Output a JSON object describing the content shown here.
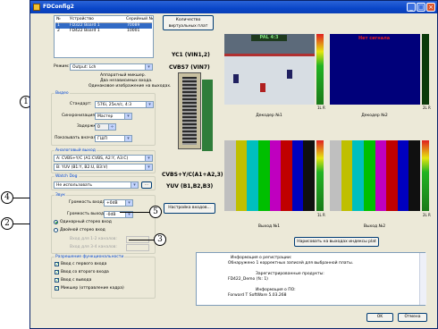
{
  "window": {
    "title": "FDConfig2"
  },
  "devices": {
    "headers": [
      "№",
      "Устройство",
      "Серийный №"
    ],
    "rows": [
      {
        "num": "1",
        "name": "FD322 Board 1",
        "serial": "70089",
        "selected": true
      },
      {
        "num": "2",
        "name": "FD422 Board 1",
        "serial": "10001",
        "selected": false
      }
    ]
  },
  "mode": {
    "label": "Режим:",
    "value": "Output: Lch"
  },
  "hw_note": [
    "Аппаратный микшер.",
    "Два независимых входа.",
    "Одинаковое изображение на выходах."
  ],
  "video": {
    "group": "Видео",
    "standard_label": "Стандарт:",
    "standard_value": "576i, 25кл/с, 4:3",
    "sync_label": "Синхронизация:",
    "sync_value": "Мастер",
    "delay_label": "Задержка:",
    "delay_value": "0",
    "show_label": "Показывать вначале:",
    "show_value": "ГШП"
  },
  "analog_out": {
    "group": "Аналоговый выход",
    "a_value": "A: CVBS+Y/C (A1:CVBS, A2:Y, A3:C)",
    "b_value": "B: YUV (B1:Y, B2:U, B3:V)"
  },
  "watchdog": {
    "group": "Watch Dog",
    "value": "Не использовать",
    "btn": "..."
  },
  "board_panel": {
    "virtual_btn": "Количество виртуальных плат",
    "top_label": "YC1 (VIN1,2)",
    "mid_label": "CVBS7 (VIN7)",
    "bot_label1": "CVBS+Y/C(A1+A2,3)",
    "bot_label2": "YUV (B1,B2,B3)",
    "inputs_btn": "Настройка входов..."
  },
  "sound": {
    "group": "Звук",
    "in_label": "Громкость входа:",
    "in_value": "+0dB",
    "out_label": "Громкость выхода:",
    "out_value": "-0dB",
    "mode1": "Одинарный стерео вход",
    "mode2": "Двойной стерео вход",
    "ch12": "Вход для 1-2 каналов:",
    "ch34": "Вход для 3-4 каналов:"
  },
  "features": {
    "group": "Разрешение функциональности",
    "items": [
      "Ввод с первого входа",
      "Ввод со второго входа",
      "Ввод с вывода",
      "Микшер (отправление кадра)"
    ]
  },
  "previews": {
    "dec1": "Декодер №1",
    "dec2": "Декодер №2",
    "out1": "Выход №1",
    "out2": "Выход №2",
    "scoreboard": "PAL  4:3",
    "noinput": "Нет сигнала",
    "m1": "1L R",
    "m2": "2L R",
    "draw_idx_btn": "Нарисовать на выходах индексы plat"
  },
  "info": {
    "title": "Информация о регистрации:",
    "lines": [
      "Обнаружено 1 корректных записей для выбранной платы.",
      "",
      "Зарегистрированные продукты:",
      "FD422_Demo (fs: 1)",
      "",
      "Информация о ПО:",
      "Forward T SoftWare 5.03.268"
    ]
  },
  "buttons": {
    "ok": "OK",
    "cancel": "Отмена"
  },
  "callouts": {
    "c1": "1",
    "c2": "2",
    "c3": "3",
    "c4": "4",
    "c5": "5"
  },
  "colors": {
    "titlebar": "#0a46c8",
    "selection": "#316ac5",
    "group_label": "#0046d5"
  }
}
